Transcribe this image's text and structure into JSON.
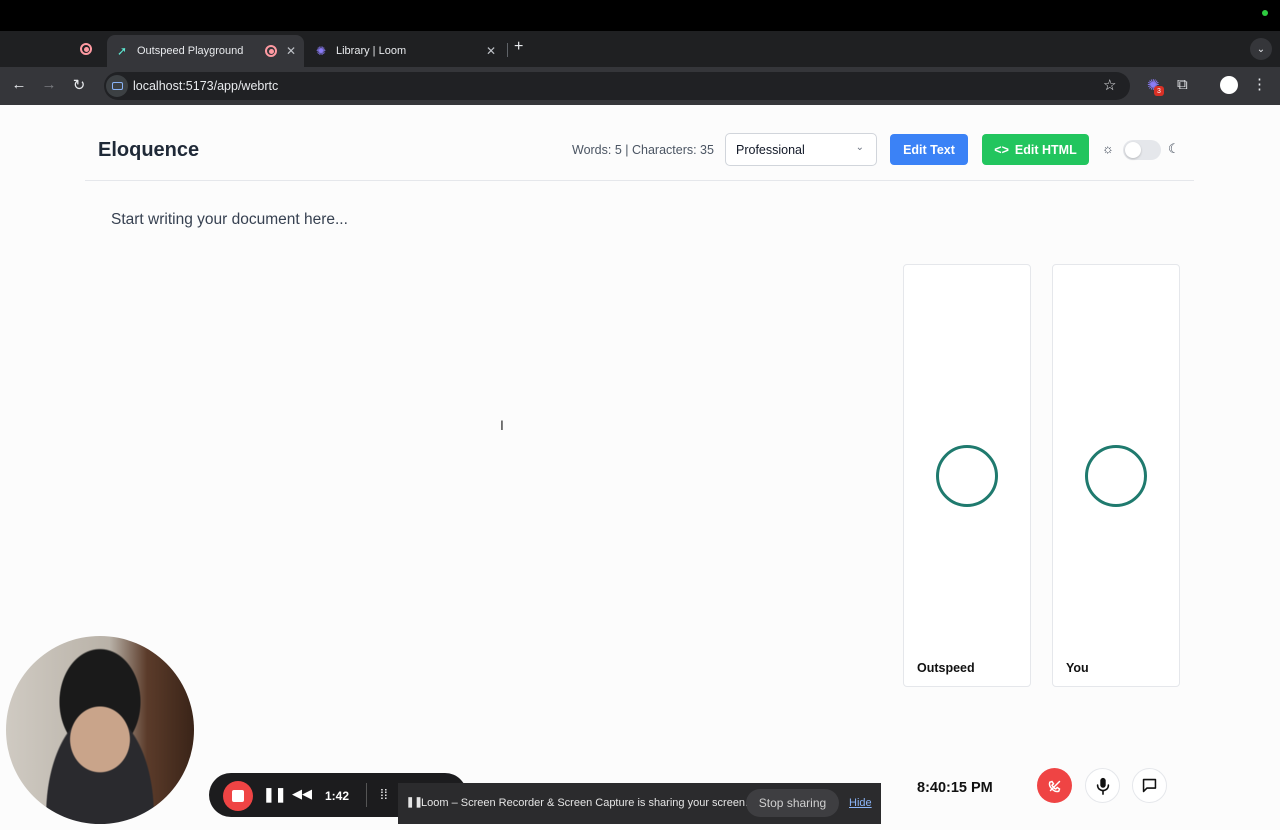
{
  "browser": {
    "tabs": [
      {
        "title": "Outspeed Playground",
        "icon": "outspeed-logo-icon",
        "active": true
      },
      {
        "title": "Library | Loom",
        "icon": "loom-logo-icon",
        "active": false
      }
    ],
    "new_tab": "+",
    "url": "localhost:5173/app/webrtc",
    "extension_badge": "3"
  },
  "app": {
    "logo": "Eloquence",
    "counts": "Words: 5 | Characters: 35",
    "tone": {
      "selected": "Professional"
    },
    "edit_text_label": "Edit Text",
    "edit_html_label": "Edit HTML",
    "edit_html_icon": "<>",
    "document_text": "Start writing your document here...",
    "participants": [
      {
        "label": "Outspeed"
      },
      {
        "label": "You"
      }
    ],
    "clock": "8:40:15 PM"
  },
  "loom": {
    "elapsed": "1:42",
    "share_message": "Loom – Screen Recorder & Screen Capture is sharing your screen.",
    "stop_sharing_label": "Stop sharing",
    "hide_label": "Hide"
  },
  "colors": {
    "edit_text_bg": "#3b82f6",
    "edit_html_bg": "#22c55e",
    "hangup_bg": "#ef4444",
    "ring": "#1f7a6e"
  }
}
